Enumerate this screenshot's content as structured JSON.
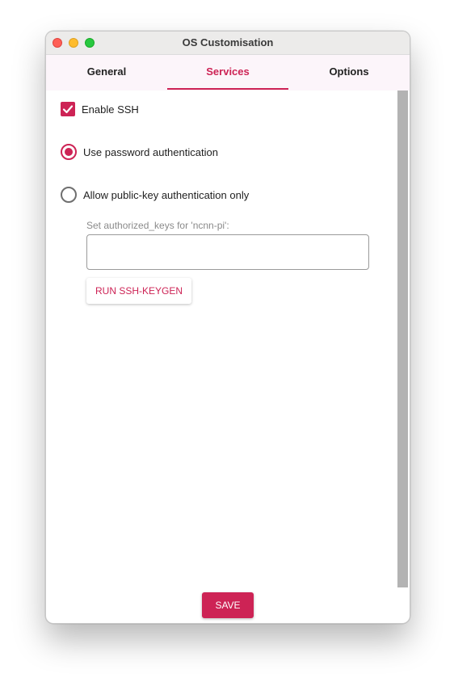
{
  "window": {
    "title": "OS Customisation"
  },
  "tabs": [
    {
      "label": "General",
      "selected": false
    },
    {
      "label": "Services",
      "selected": true
    },
    {
      "label": "Options",
      "selected": false
    }
  ],
  "services": {
    "enable_ssh": {
      "label": "Enable SSH",
      "checked": true
    },
    "auth_password": {
      "label": "Use password authentication",
      "selected": true
    },
    "auth_pubkey": {
      "label": "Allow public-key authentication only",
      "selected": false
    },
    "authorized_keys": {
      "label": "Set authorized_keys for 'ncnn-pi':",
      "value": ""
    },
    "keygen_button": "RUN SSH-KEYGEN"
  },
  "footer": {
    "save_label": "SAVE"
  },
  "colors": {
    "accent": "#cd2355",
    "tab_background": "#fcf5fa",
    "scrollbar_thumb": "#b3b3b3"
  },
  "icons": {
    "close": "close-icon",
    "minimize": "minimize-icon",
    "maximize": "maximize-icon",
    "checkmark": "checkmark-icon"
  }
}
